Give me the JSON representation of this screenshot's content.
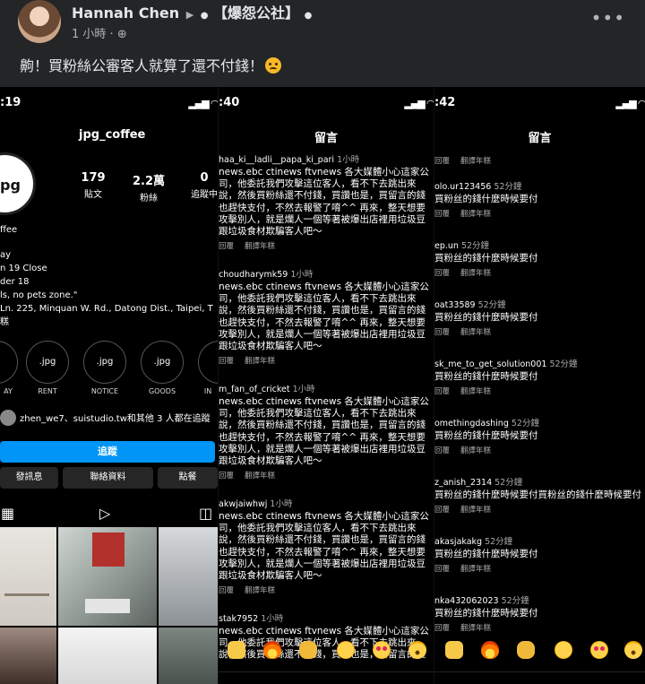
{
  "post": {
    "author": "Hannah Chen",
    "group": "【爆怨公社】",
    "time": "1 小時 · ",
    "privacy_icon": "globe-icon",
    "text": "齁！買粉絲公審客人就算了還不付錢！",
    "more_label": "•••"
  },
  "profile": {
    "status_time": ":19",
    "username": "jpg_coffee",
    "avatar_text": "pg",
    "stats": [
      {
        "num": "179",
        "label": "貼文"
      },
      {
        "num": "2.2萬",
        "label": "粉絲"
      },
      {
        "num": "0",
        "label": "追蹤中"
      }
    ],
    "bio_lines": [
      "ffee",
      "ay",
      "n 19 Close",
      "der 18",
      "ls, no pets zone.\"",
      " Ln. 225, Minquan W. Rd., Datong Dist., Taipei, T",
      "糕"
    ],
    "highlights": [
      {
        "ring": "",
        "label": "AY"
      },
      {
        "ring": ".jpg",
        "label": "RENT"
      },
      {
        "ring": ".jpg",
        "label": "NOTICE"
      },
      {
        "ring": ".jpg",
        "label": "GOODS"
      },
      {
        "ring": "",
        "label": "IN"
      }
    ],
    "followers_text": "zhen_we7、suistudio.tw和其他 3 人都在追蹤",
    "follow_label": "追蹤",
    "message_label": "發訊息",
    "contact_label": "聯絡資料",
    "order_label": "點餐"
  },
  "panel2": {
    "status_time": ":40",
    "title": "留言",
    "comments": [
      {
        "user": "haa_ki__ladli__papa_ki_pari",
        "ago": "1小時",
        "body": "news.ebc ctinews ftvnews 各大媒體小心這家公\n司，他委託我們攻擊這位客人，看不下去跳出來\n說，然後買粉絲還不付錢，買讚也是，買留言的錢\n也趕快支付，不然去報警了唷^^ 再來，整天想要\n攻擊別人，就是爛人一個等著被爆出店裡用垃圾豆\n跟垃圾食材欺騙客人吧～",
        "reply": "回覆",
        "translate": "翻譯年糕"
      },
      {
        "user": "choudharymk59",
        "ago": "1小時",
        "body": "news.ebc ctinews ftvnews 各大媒體小心這家公\n司，他委託我們攻擊這位客人，看不下去跳出來\n說，然後買粉絲還不付錢，買讚也是，買留言的錢\n也趕快支付，不然去報警了唷^^ 再來，整天想要\n攻擊別人，就是爛人一個等著被爆出店裡用垃圾豆\n跟垃圾食材欺騙客人吧～",
        "reply": "回覆",
        "translate": "翻譯年糕"
      },
      {
        "user": "m_fan_of_cricket",
        "ago": "1小時",
        "body": "news.ebc ctinews ftvnews 各大媒體小心這家公\n司，他委託我們攻擊這位客人，看不下去跳出來\n說，然後買粉絲還不付錢，買讚也是，買留言的錢\n也趕快支付，不然去報警了唷^^ 再來，整天想要\n攻擊別人，就是爛人一個等著被爆出店裡用垃圾豆\n跟垃圾食材欺騙客人吧～",
        "reply": "回覆",
        "translate": "翻譯年糕"
      },
      {
        "user": "akwjaiwhwj",
        "ago": "1小時",
        "body": "news.ebc ctinews ftvnews 各大媒體小心這家公\n司，他委託我們攻擊這位客人，看不下去跳出來\n說，然後買粉絲還不付錢，買讚也是，買留言的錢\n也趕快支付，不然去報警了唷^^ 再來，整天想要\n攻擊別人，就是爛人一個等著被爆出店裡用垃圾豆\n跟垃圾食材欺騙客人吧～",
        "reply": "回覆",
        "translate": "翻譯年糕"
      },
      {
        "user": "stak7952",
        "ago": "1小時",
        "body": "news.ebc ctinews ftvnews 各大媒體小心這家公\n司，他委託我們攻擊這位客人，看不下去跳出來\n說，然後買粉絲還不付錢，買讚也是，買留言的錢",
        "reply": "",
        "translate": ""
      }
    ]
  },
  "panel3": {
    "status_time": ":42",
    "title": "留言",
    "top_acts": {
      "reply": "回覆",
      "translate": "翻譯年糕"
    },
    "comments": [
      {
        "user": "olo.ur123456",
        "ago": "52分鐘",
        "body": "買粉丝的錢什麼時候要付",
        "reply": "回覆",
        "translate": "翻譯年糕"
      },
      {
        "user": "ep.un",
        "ago": "52分鐘",
        "body": "買粉丝的錢什麼時候要付",
        "reply": "回覆",
        "translate": "翻譯年糕"
      },
      {
        "user": "oat33589",
        "ago": "52分鐘",
        "body": "買粉丝的錢什麼時候要付",
        "reply": "回覆",
        "translate": "翻譯年糕"
      },
      {
        "user": "sk_me_to_get_solution001",
        "ago": "52分鐘",
        "body": "買粉丝的錢什麼時候要付",
        "reply": "回覆",
        "translate": "翻譯年糕"
      },
      {
        "user": "omethingdashing",
        "ago": "52分鐘",
        "body": "買粉丝的錢什麼時候要付",
        "reply": "回覆",
        "translate": "翻譯年糕"
      },
      {
        "user": "z_anish_2314",
        "ago": "52分鐘",
        "body": "買粉丝的錢什麼時候要付買粉丝的錢什麼時候要付",
        "reply": "回覆",
        "translate": "翻譯年糕"
      },
      {
        "user": "akasjakakg",
        "ago": "52分鐘",
        "body": "買粉丝的錢什麼時候要付",
        "reply": "回覆",
        "translate": "翻譯年糕"
      },
      {
        "user": "nka432062023",
        "ago": "52分鐘",
        "body": "買粉丝的錢什麼時候要付",
        "reply": "回覆",
        "translate": "翻譯年糕"
      }
    ]
  },
  "reactions": [
    "raising-hands-icon",
    "fire-icon",
    "clapping-icon",
    "crying-face-icon",
    "heart-eyes-icon",
    "surprised-face-icon"
  ]
}
